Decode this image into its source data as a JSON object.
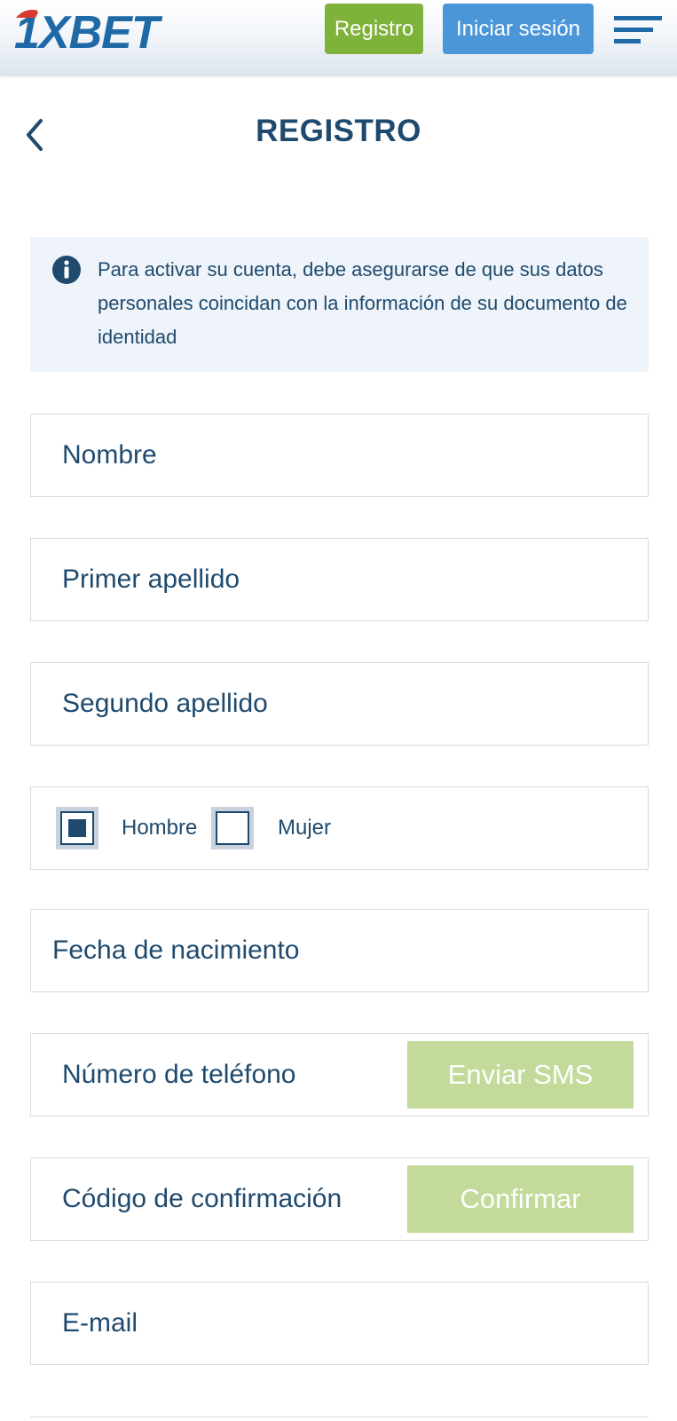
{
  "header": {
    "logo_text": "1XBET",
    "register_label": "Registro",
    "login_label": "Iniciar sesión",
    "menu_icon": "hamburger-menu-icon"
  },
  "page": {
    "back_icon": "chevron-left-icon",
    "title": "REGISTRO"
  },
  "info": {
    "icon": "info-icon",
    "text": "Para activar su cuenta, debe asegurarse de que sus datos personales coincidan con la información de su documento de identidad"
  },
  "form": {
    "first_name": "Nombre",
    "last_name_1": "Primer apellido",
    "last_name_2": "Segundo apellido",
    "gender": {
      "male": "Hombre",
      "female": "Mujer",
      "selected": "Hombre"
    },
    "birth_date": "Fecha de nacimiento",
    "phone": "Número de teléfono",
    "send_sms": "Enviar SMS",
    "confirmation_code": "Código de confirmación",
    "confirm": "Confirmar",
    "email": "E-mail"
  },
  "colors": {
    "primary_text": "#1f4a6e",
    "register_green": "#7fb23a",
    "login_blue": "#4b96d8",
    "disabled_green": "#c3da9b",
    "info_bg": "#eef4f9"
  }
}
